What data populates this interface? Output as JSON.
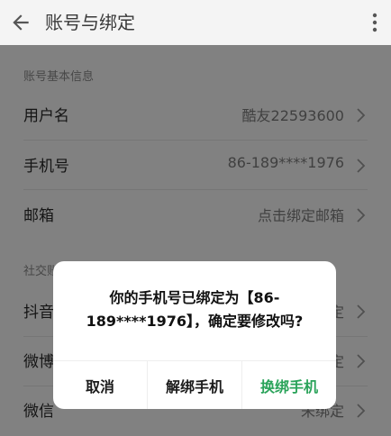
{
  "header": {
    "title": "账号与绑定",
    "back_icon": "back-arrow-icon",
    "more_icon": "more-vertical-icon"
  },
  "sections": [
    {
      "label": "账号基本信息",
      "rows": [
        {
          "label": "用户名",
          "value": "酷友22593600"
        },
        {
          "label": "手机号",
          "value": "86-189****1976"
        },
        {
          "label": "邮箱",
          "value": "点击绑定邮箱"
        }
      ]
    },
    {
      "label": "社交账",
      "rows": [
        {
          "label": "抖音",
          "value": "定"
        },
        {
          "label": "微博",
          "value": "定"
        },
        {
          "label": "微信",
          "value": "未绑定"
        }
      ]
    }
  ],
  "dialog": {
    "message": "你的手机号已绑定为【86-189****1976】，确定要修改吗?",
    "buttons": {
      "cancel": "取消",
      "unbind": "解绑手机",
      "change": "换绑手机"
    },
    "accent_color": "#2aa35a"
  }
}
